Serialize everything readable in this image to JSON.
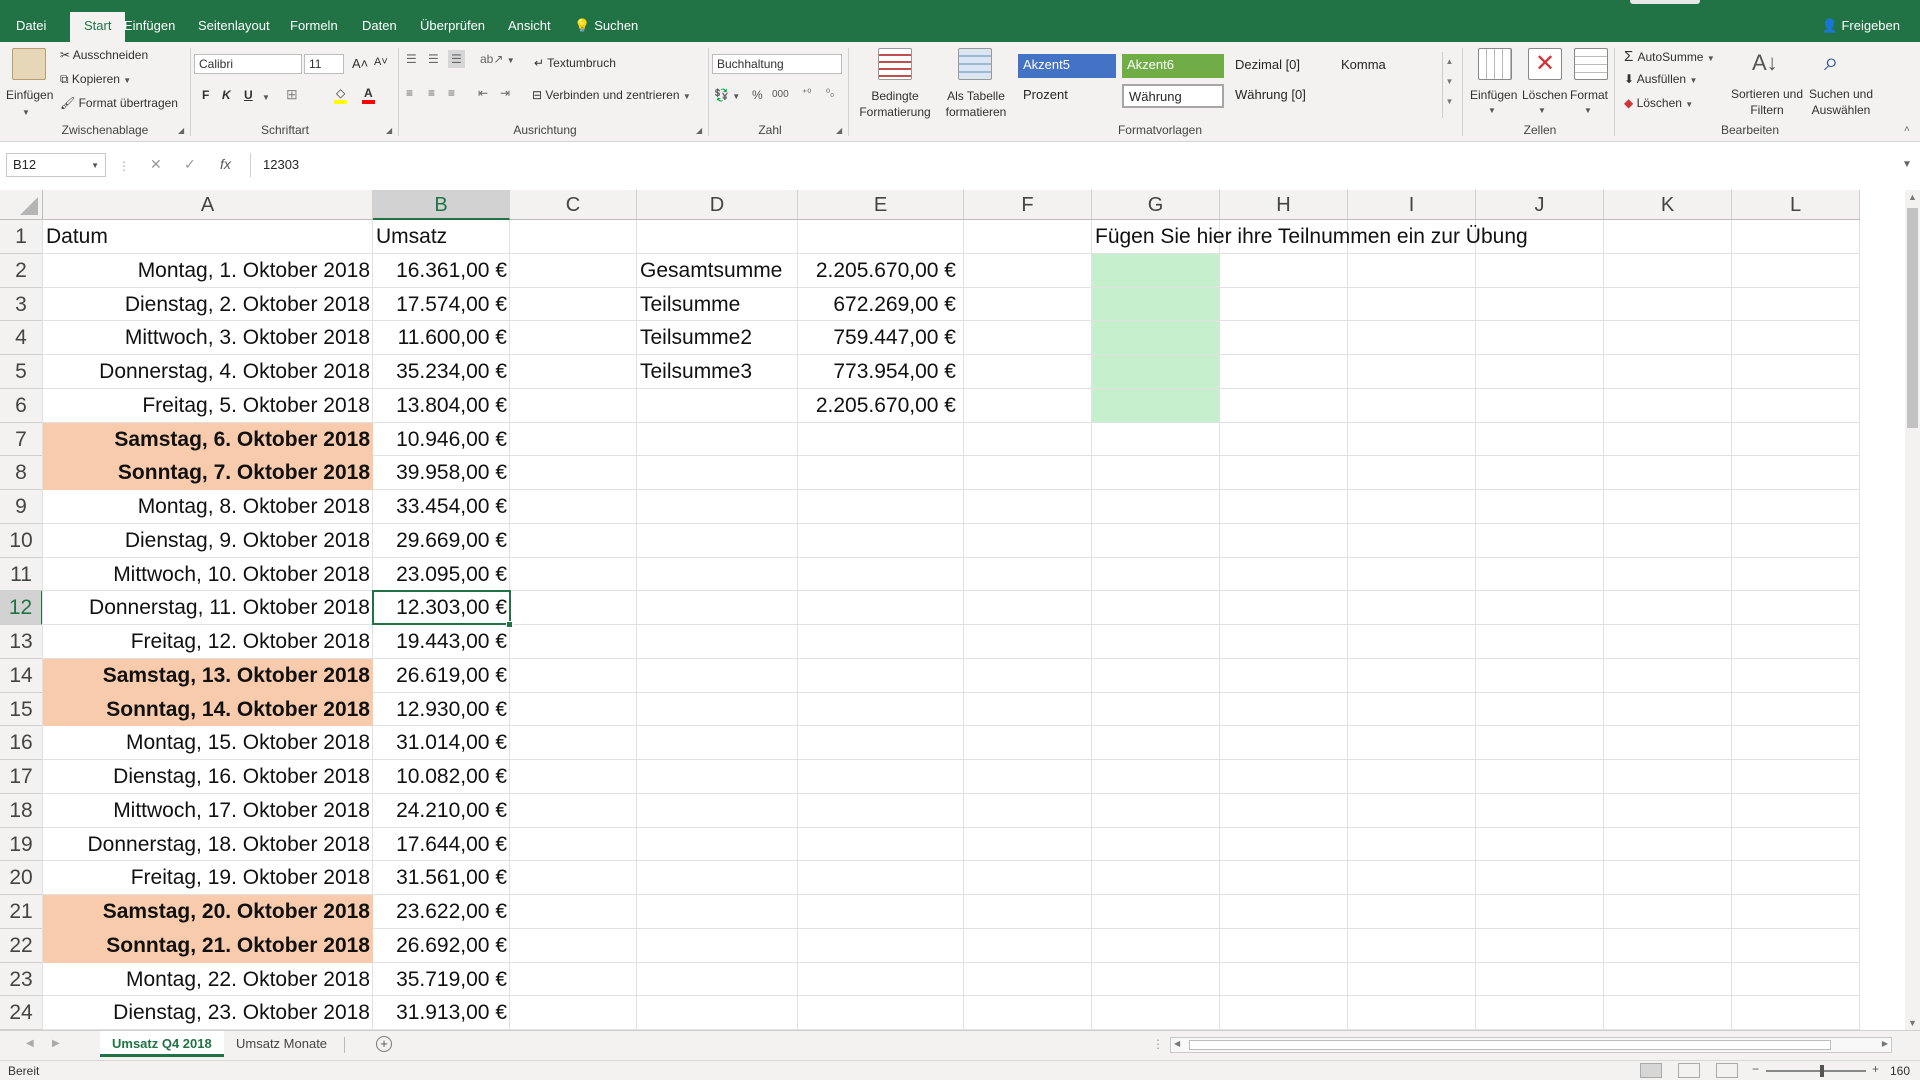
{
  "ribbon_tabs": [
    "Datei",
    "Start",
    "Einfügen",
    "Seitenlayout",
    "Formeln",
    "Daten",
    "Überprüfen",
    "Ansicht",
    "Suchen"
  ],
  "share_label": "Freigeben",
  "clipboard": {
    "paste": "Einfügen",
    "cut": "Ausschneiden",
    "copy": "Kopieren",
    "format_painter": "Format übertragen",
    "group": "Zwischenablage"
  },
  "font": {
    "name": "Calibri",
    "size": "11",
    "bold": "F",
    "italic": "K",
    "underline": "U",
    "group": "Schriftart"
  },
  "alignment": {
    "wrap": "Textumbruch",
    "merge": "Verbinden und zentrieren",
    "group": "Ausrichtung"
  },
  "number": {
    "format": "Buchhaltung",
    "group": "Zahl"
  },
  "styles": {
    "conditional": "Bedingte Formatierung",
    "as_table": "Als Tabelle formatieren",
    "cells": [
      "Akzent5",
      "Akzent6",
      "Dezimal [0]",
      "Komma",
      "Prozent",
      "Währung",
      "Währung [0]"
    ],
    "group": "Formatvorlagen"
  },
  "cells_group": {
    "insert": "Einfügen",
    "delete": "Löschen",
    "format": "Format",
    "group": "Zellen"
  },
  "editing": {
    "autosum": "AutoSumme",
    "fill": "Ausfüllen",
    "clear": "Löschen",
    "sort": "Sortieren und Filtern",
    "find": "Suchen und Auswählen",
    "group": "Bearbeiten"
  },
  "formula_bar": {
    "name_box": "B12",
    "value": "12303"
  },
  "columns": [
    "A",
    "B",
    "C",
    "D",
    "E",
    "F",
    "G",
    "H",
    "I",
    "J",
    "K",
    "L"
  ],
  "rows": [
    {
      "n": "1",
      "a": "Datum",
      "b": "Umsatz"
    },
    {
      "n": "2",
      "a": "Montag, 1. Oktober 2018",
      "b": "16.361,00 €"
    },
    {
      "n": "3",
      "a": "Dienstag, 2. Oktober 2018",
      "b": "17.574,00 €"
    },
    {
      "n": "4",
      "a": "Mittwoch, 3. Oktober 2018",
      "b": "11.600,00 €"
    },
    {
      "n": "5",
      "a": "Donnerstag, 4. Oktober 2018",
      "b": "35.234,00 €"
    },
    {
      "n": "6",
      "a": "Freitag, 5. Oktober 2018",
      "b": "13.804,00 €"
    },
    {
      "n": "7",
      "a": "Samstag, 6. Oktober 2018",
      "b": "10.946,00 €",
      "weekend": true
    },
    {
      "n": "8",
      "a": "Sonntag, 7. Oktober 2018",
      "b": "39.958,00 €",
      "weekend": true
    },
    {
      "n": "9",
      "a": "Montag, 8. Oktober 2018",
      "b": "33.454,00 €"
    },
    {
      "n": "10",
      "a": "Dienstag, 9. Oktober 2018",
      "b": "29.669,00 €"
    },
    {
      "n": "11",
      "a": "Mittwoch, 10. Oktober 2018",
      "b": "23.095,00 €"
    },
    {
      "n": "12",
      "a": "Donnerstag, 11. Oktober 2018",
      "b": "12.303,00 €"
    },
    {
      "n": "13",
      "a": "Freitag, 12. Oktober 2018",
      "b": "19.443,00 €"
    },
    {
      "n": "14",
      "a": "Samstag, 13. Oktober 2018",
      "b": "26.619,00 €",
      "weekend": true
    },
    {
      "n": "15",
      "a": "Sonntag, 14. Oktober 2018",
      "b": "12.930,00 €",
      "weekend": true
    },
    {
      "n": "16",
      "a": "Montag, 15. Oktober 2018",
      "b": "31.014,00 €"
    },
    {
      "n": "17",
      "a": "Dienstag, 16. Oktober 2018",
      "b": "10.082,00 €"
    },
    {
      "n": "18",
      "a": "Mittwoch, 17. Oktober 2018",
      "b": "24.210,00 €"
    },
    {
      "n": "19",
      "a": "Donnerstag, 18. Oktober 2018",
      "b": "17.644,00 €"
    },
    {
      "n": "20",
      "a": "Freitag, 19. Oktober 2018",
      "b": "31.561,00 €"
    },
    {
      "n": "21",
      "a": "Samstag, 20. Oktober 2018",
      "b": "23.622,00 €",
      "weekend": true
    },
    {
      "n": "22",
      "a": "Sonntag, 21. Oktober 2018",
      "b": "26.692,00 €",
      "weekend": true
    },
    {
      "n": "23",
      "a": "Montag, 22. Oktober 2018",
      "b": "35.719,00 €"
    },
    {
      "n": "24",
      "a": "Dienstag, 23. Oktober 2018",
      "b": "31.913,00 €"
    }
  ],
  "summary": [
    {
      "label": "Gesamtsumme",
      "value": "2.205.670,00 €"
    },
    {
      "label": "Teilsumme",
      "value": "672.269,00 €"
    },
    {
      "label": "Teilsumme2",
      "value": "759.447,00 €"
    },
    {
      "label": "Teilsumme3",
      "value": "773.954,00 €"
    },
    {
      "label": "",
      "value": "2.205.670,00 €"
    }
  ],
  "instruction": "Fügen Sie hier ihre Teilnummen ein zur Übung",
  "sheets": [
    "Umsatz Q4 2018",
    "Umsatz Monate"
  ],
  "status": "Bereit",
  "zoom": "160 %",
  "colors": {
    "accent": "#217346",
    "weekend": "#f8cbad",
    "exercise": "#c6efce",
    "akzent5": "#4472c4",
    "akzent6": "#70ad47"
  }
}
